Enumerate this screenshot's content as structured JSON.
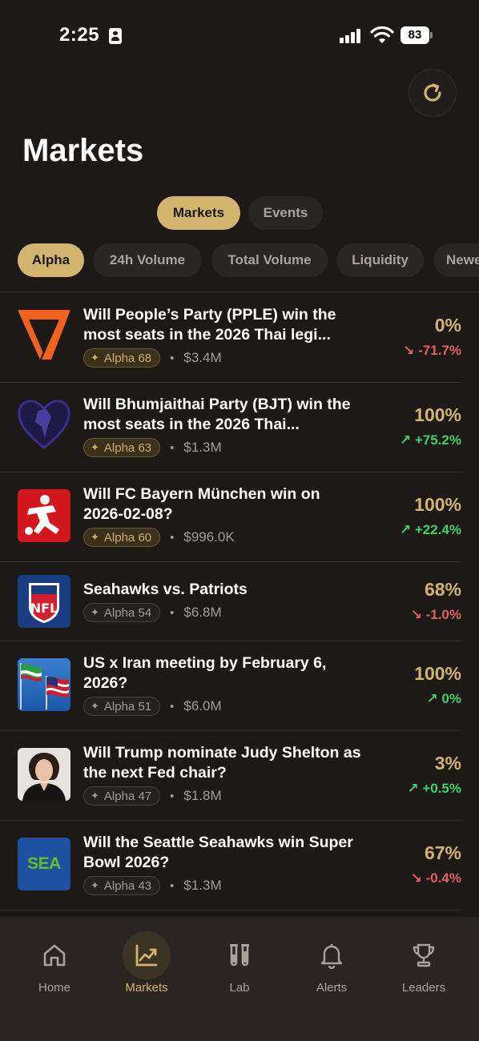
{
  "status": {
    "time": "2:25",
    "battery": "83"
  },
  "page": {
    "title": "Markets"
  },
  "segments": [
    {
      "label": "Markets",
      "active": true
    },
    {
      "label": "Events",
      "active": false
    }
  ],
  "filters": [
    {
      "label": "Alpha",
      "active": true
    },
    {
      "label": "24h Volume",
      "active": false
    },
    {
      "label": "Total Volume",
      "active": false
    },
    {
      "label": "Liquidity",
      "active": false
    },
    {
      "label": "Newe",
      "active": false
    }
  ],
  "markets": [
    {
      "question": "Will People’s Party (PPLE) win the most seats in the 2026 Thai legi...",
      "alpha": "Alpha 68",
      "badge_style": "gold",
      "volume": "$3.4M",
      "percent": "0%",
      "change": "-71.7%",
      "direction": "down",
      "icon": "people-party-logo-icon"
    },
    {
      "question": "Will Bhumjaithai Party (BJT) win the most seats in the 2026 Thai...",
      "alpha": "Alpha 63",
      "badge_style": "gold",
      "volume": "$1.3M",
      "percent": "100%",
      "change": "+75.2%",
      "direction": "up",
      "icon": "bhumjaithai-logo-icon"
    },
    {
      "question": "Will FC Bayern München win on 2026-02-08?",
      "alpha": "Alpha 60",
      "badge_style": "gold",
      "volume": "$996.0K",
      "percent": "100%",
      "change": "+22.4%",
      "direction": "up",
      "icon": "bundesliga-logo-icon"
    },
    {
      "question": "Seahawks vs. Patriots",
      "alpha": "Alpha 54",
      "badge_style": "grey",
      "volume": "$6.8M",
      "percent": "68%",
      "change": "-1.0%",
      "direction": "down",
      "icon": "nfl-logo-icon"
    },
    {
      "question": "US x Iran meeting by February 6, 2026?",
      "alpha": "Alpha 51",
      "badge_style": "grey",
      "volume": "$6.0M",
      "percent": "100%",
      "change": "0%",
      "direction": "up",
      "icon": "flags-photo-icon"
    },
    {
      "question": "Will Trump nominate Judy Shelton as the next Fed chair?",
      "alpha": "Alpha 47",
      "badge_style": "grey",
      "volume": "$1.8M",
      "percent": "3%",
      "change": "+0.5%",
      "direction": "up",
      "icon": "portrait-photo-icon"
    },
    {
      "question": "Will the Seattle Seahawks win Super Bowl 2026?",
      "alpha": "Alpha 43",
      "badge_style": "grey",
      "volume": "$1.3M",
      "percent": "67%",
      "change": "-0.4%",
      "direction": "down",
      "icon": "sea-logo-icon",
      "logo_text": "SEA"
    }
  ],
  "nfl_logo_text": "NFL",
  "tabs": [
    {
      "label": "Home",
      "icon": "home-icon",
      "active": false
    },
    {
      "label": "Markets",
      "icon": "chart-icon",
      "active": true
    },
    {
      "label": "Lab",
      "icon": "lab-icon",
      "active": false
    },
    {
      "label": "Alerts",
      "icon": "bell-icon",
      "active": false
    },
    {
      "label": "Leaders",
      "icon": "trophy-icon",
      "active": false
    }
  ],
  "colors": {
    "accent": "#d2b46f",
    "up": "#3fcf6c",
    "down": "#e26161",
    "background": "#1c1916"
  }
}
